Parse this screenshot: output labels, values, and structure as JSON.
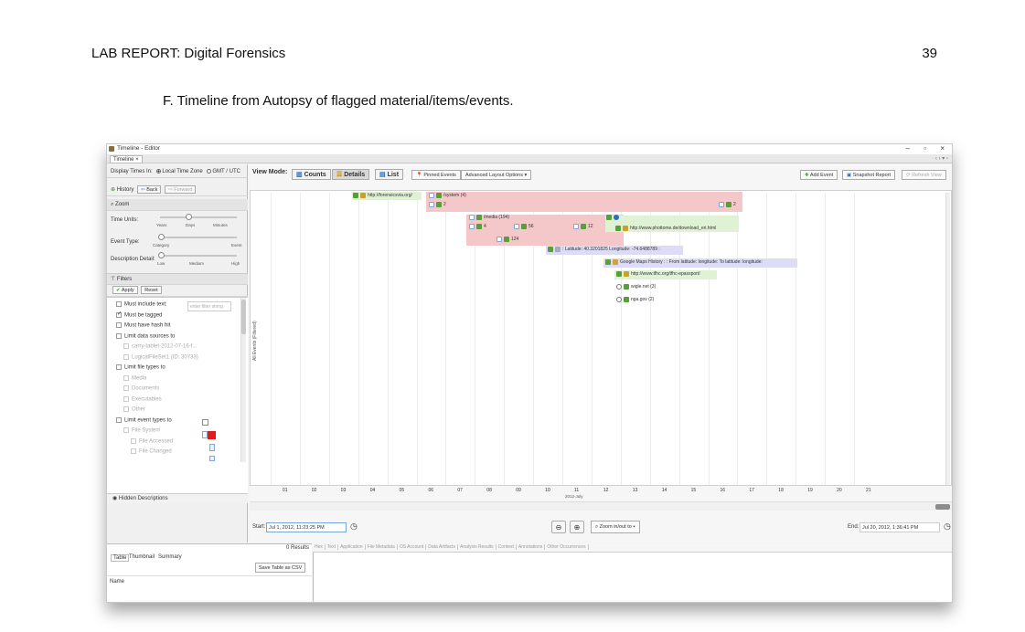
{
  "document": {
    "header_title": "LAB REPORT: Digital Forensics",
    "page_number": "39",
    "section_heading": "F.  Timeline from Autopsy of flagged material/items/events."
  },
  "app": {
    "window_title": "Timeline - Editor",
    "tab_label": "Timeline",
    "tab_close": "×",
    "window_controls": {
      "minimize": "–",
      "restore": "▫",
      "close": "×"
    },
    "display_times": {
      "label": "Display Times In:",
      "local": "Local Time Zone",
      "gmt": "GMT / UTC"
    },
    "history": {
      "history_label": "History",
      "back_label": "Back",
      "forward_label": "Forward"
    },
    "zoom": {
      "header": "Zoom",
      "time_units_label": "Time Units:",
      "time_units_ticks": [
        "Years",
        "Days",
        "Minutes"
      ],
      "event_type_label": "Event Type:",
      "event_type_ticks": [
        "Category",
        "Event"
      ],
      "description_detail_label": "Description Detail:",
      "description_ticks": [
        "Low",
        "Medium",
        "High"
      ]
    },
    "filters": {
      "header": "Filters",
      "apply_label": "Apply",
      "reset_label": "Reset",
      "filter_text_placeholder": "enter filter string",
      "items": [
        {
          "label": "Must include text:",
          "checked": false,
          "enabled": true,
          "indent": 0
        },
        {
          "label": "Must be tagged",
          "checked": true,
          "enabled": true,
          "indent": 0
        },
        {
          "label": "Must have hash hit",
          "checked": false,
          "enabled": true,
          "indent": 0
        },
        {
          "label": "Limit data sources to",
          "checked": false,
          "enabled": true,
          "indent": 0
        },
        {
          "label": "carry-tablet-2012-07-16-f...",
          "checked": false,
          "enabled": false,
          "indent": 1
        },
        {
          "label": "LogicalFileSet1 (ID: 30733)",
          "checked": false,
          "enabled": false,
          "indent": 1
        },
        {
          "label": "Limit file types to",
          "checked": false,
          "enabled": true,
          "indent": 0
        },
        {
          "label": "Media",
          "checked": false,
          "enabled": false,
          "indent": 1
        },
        {
          "label": "Documents",
          "checked": false,
          "enabled": false,
          "indent": 1
        },
        {
          "label": "Executables",
          "checked": false,
          "enabled": false,
          "indent": 1
        },
        {
          "label": "Other",
          "checked": false,
          "enabled": false,
          "indent": 1
        },
        {
          "label": "Limit event types to",
          "checked": false,
          "enabled": true,
          "indent": 0
        },
        {
          "label": "File System",
          "checked": false,
          "enabled": false,
          "indent": 1
        },
        {
          "label": "File Accessed",
          "checked": false,
          "enabled": false,
          "indent": 2
        },
        {
          "label": "File Changed",
          "checked": false,
          "enabled": false,
          "indent": 2
        }
      ],
      "hidden_descriptions_label": "Hidden Descriptions"
    },
    "view_mode": {
      "label": "View Mode:",
      "counts": "Counts",
      "details": "Details",
      "list": "List",
      "pinned_events": "Pinned Events",
      "advanced_layout": "Advanced Layout Options",
      "add_event": "Add Event",
      "snapshot_report": "Snapshot Report",
      "refresh_view": "Refresh View"
    },
    "timeline": {
      "y_axis_label": "All Events (Filtered)",
      "x_ticks": [
        "01",
        "02",
        "03",
        "04",
        "05",
        "06",
        "07",
        "08",
        "09",
        "10",
        "11",
        "12",
        "13",
        "14",
        "15",
        "16",
        "17",
        "18",
        "19",
        "20",
        "21"
      ],
      "month_label": "2012-July",
      "events": [
        {
          "text": "http://forensicsvia.org/",
          "count": ""
        },
        {
          "text": "/system",
          "count": "(4)"
        },
        {
          "text": "",
          "count": "2"
        },
        {
          "text": "",
          "count": "2"
        },
        {
          "text": "/media",
          "count": "(194)"
        },
        {
          "text": "",
          "count": "4"
        },
        {
          "text": "",
          "count": "56"
        },
        {
          "text": "",
          "count": "12"
        },
        {
          "text": "",
          "count": "124"
        },
        {
          "text": "http://www.phottome.de/download_eri.html",
          "count": ""
        },
        {
          "text": ": Latitude: 40.3201825 Longitude: -74.6488789 :",
          "count": ""
        },
        {
          "text": "Google Maps History : : From latitude: longitude: To latitude: longitude:",
          "count": ""
        },
        {
          "text": "http://www.tfhc.org/tfhc-epassport/",
          "count": ""
        },
        {
          "text": "wigle.net",
          "count": "(3)"
        },
        {
          "text": "nga.gov",
          "count": "(2)"
        }
      ]
    },
    "range": {
      "start_label": "Start:",
      "start_value": "Jul 1, 2012, 11:23:25 PM",
      "end_label": "End:",
      "end_value": "Jul 20, 2012, 1:36:41 PM",
      "zoom_in_out_label": "Zoom in/out to"
    },
    "bottom": {
      "results_label": "0  Results",
      "tabs": [
        "Table",
        "Thumbnail",
        "Summary"
      ],
      "save_csv_label": "Save Table as CSV",
      "name_column": "Name",
      "result_tabs": [
        "Hex",
        "Text",
        "Application",
        "File Metadata",
        "OS Account",
        "Data Artifacts",
        "Analysis Results",
        "Context",
        "Annotations",
        "Other Occurrences"
      ]
    }
  }
}
